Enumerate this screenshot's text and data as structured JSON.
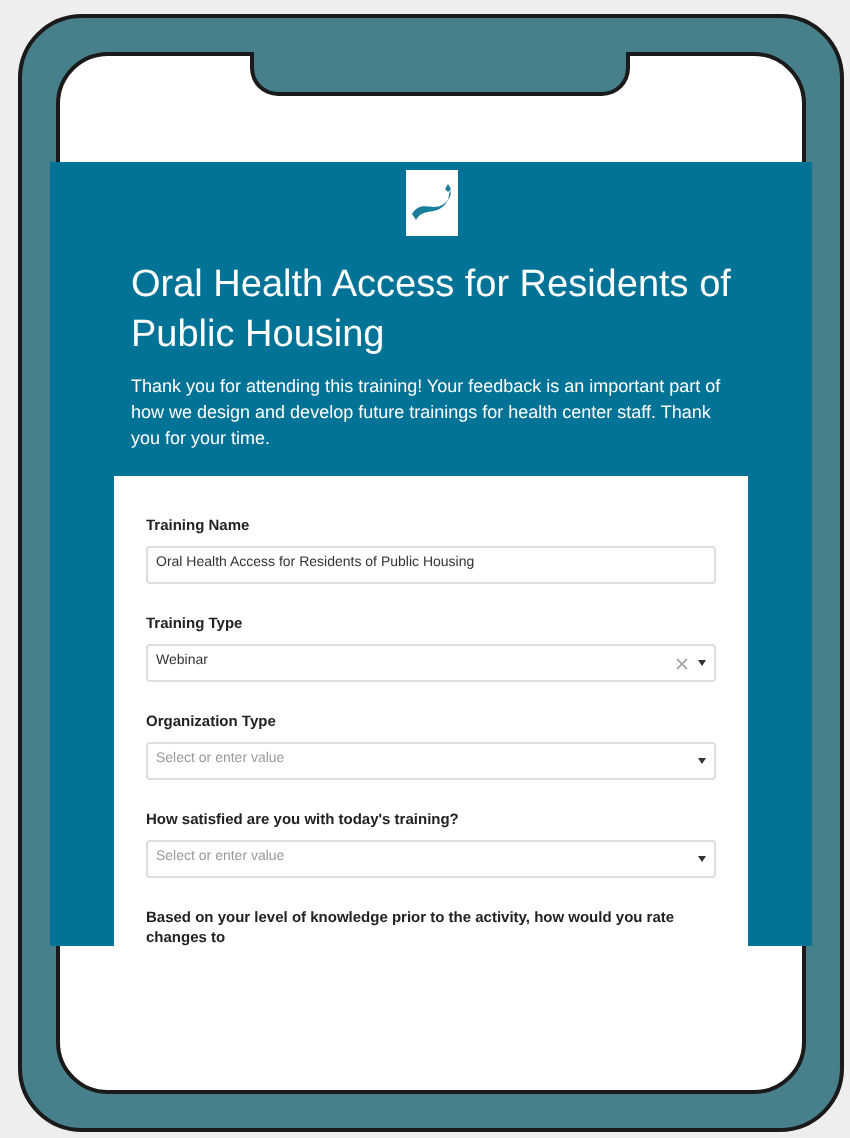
{
  "header": {
    "title": "Oral Health Access for Residents of Public Housing",
    "intro": "Thank you for attending this training! Your feedback is an important part of how we design and develop future trainings for health center staff. Thank you for your time."
  },
  "fields": [
    {
      "kind": "text",
      "label": "Training Name",
      "value": "Oral Health Access for Residents of Public Housing"
    },
    {
      "kind": "select",
      "label": "Training Type",
      "value": "Webinar",
      "clearable": true
    },
    {
      "kind": "select",
      "label": "Organization Type",
      "placeholder": "Select or enter value",
      "clearable": false
    },
    {
      "kind": "select",
      "label": "How satisfied are you with today's training?",
      "placeholder": "Select or enter value",
      "clearable": false
    },
    {
      "kind": "question",
      "label": "Based on your level of knowledge prior to the activity, how would you rate changes to"
    }
  ]
}
